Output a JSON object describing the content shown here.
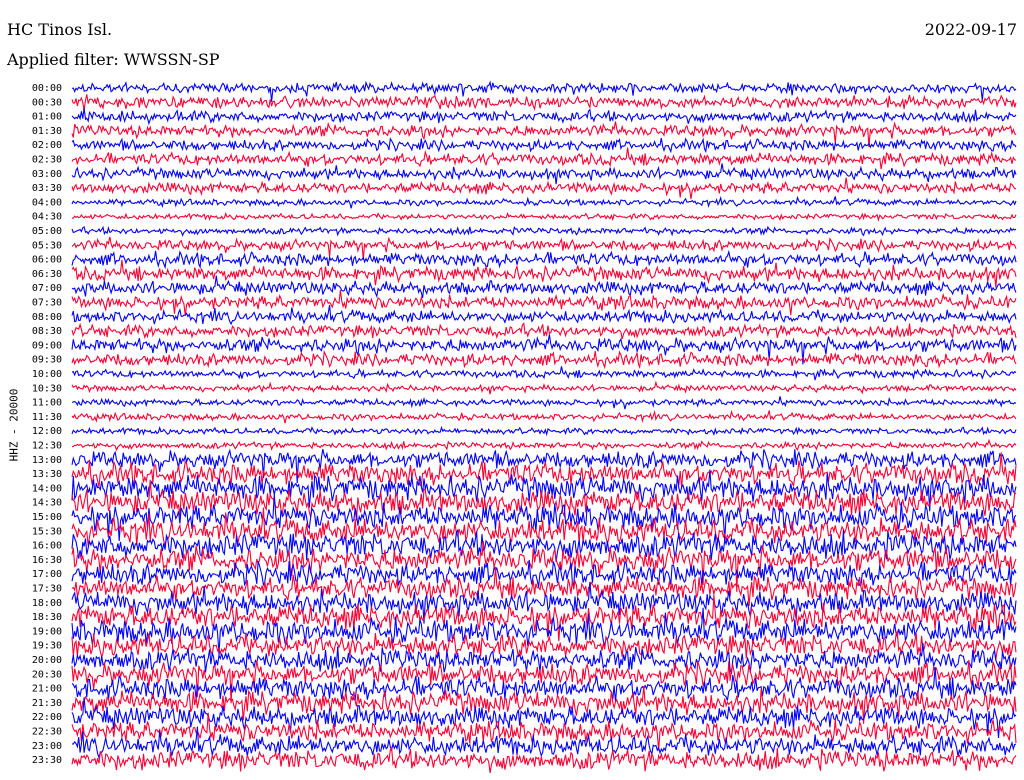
{
  "header": {
    "station": "HC Tinos Isl.",
    "date": "2022-09-17",
    "filter": "Applied filter: WWSSN-SP"
  },
  "chart_data": {
    "type": "line",
    "subtype": "helicorder",
    "ylabel": "HHZ - 20000",
    "row_labels": [
      "00:00",
      "00:30",
      "01:00",
      "01:30",
      "02:00",
      "02:30",
      "03:00",
      "03:30",
      "04:00",
      "04:30",
      "05:00",
      "05:30",
      "06:00",
      "06:30",
      "07:00",
      "07:30",
      "08:00",
      "08:30",
      "09:00",
      "09:30",
      "10:00",
      "10:30",
      "11:00",
      "11:30",
      "12:00",
      "12:30",
      "13:00",
      "13:30",
      "14:00",
      "14:30",
      "15:00",
      "15:30",
      "16:00",
      "16:30",
      "17:00",
      "17:30",
      "18:00",
      "18:30",
      "19:00",
      "19:30",
      "20:00",
      "20:30",
      "21:00",
      "21:30",
      "22:00",
      "22:30",
      "23:00",
      "23:30"
    ],
    "trace_colors": [
      "#0000ff",
      "#ff0033"
    ],
    "row_amplitude_relative": [
      0.45,
      0.55,
      0.5,
      0.55,
      0.5,
      0.55,
      0.5,
      0.5,
      0.28,
      0.25,
      0.3,
      0.5,
      0.6,
      0.65,
      0.6,
      0.6,
      0.55,
      0.55,
      0.65,
      0.6,
      0.35,
      0.28,
      0.3,
      0.3,
      0.28,
      0.3,
      0.8,
      1.0,
      1.1,
      1.1,
      1.1,
      1.1,
      1.15,
      1.1,
      1.0,
      1.0,
      1.0,
      1.1,
      1.1,
      1.0,
      1.0,
      1.0,
      1.0,
      1.0,
      0.95,
      0.9,
      0.9,
      0.9
    ]
  }
}
